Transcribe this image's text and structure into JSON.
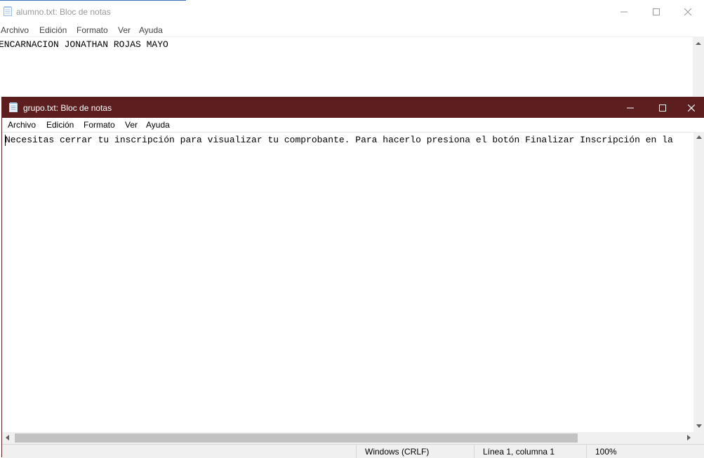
{
  "back_window": {
    "title": "alumno.txt: Bloc de notas",
    "menu": [
      "Archivo",
      "Edición",
      "Formato",
      "Ver",
      "Ayuda"
    ],
    "content": "ENCARNACION JONATHAN ROJAS MAYO"
  },
  "front_window": {
    "title": "grupo.txt: Bloc de notas",
    "titlebar_color": "#5c1e1e",
    "menu": [
      "Archivo",
      "Edición",
      "Formato",
      "Ver",
      "Ayuda"
    ],
    "content": "Necesitas cerrar tu inscripción para visualizar tu comprobante. Para hacerlo presiona el botón Finalizar Inscripción en la",
    "status": {
      "line_ending": "Windows (CRLF)",
      "position": "Línea 1, columna 1",
      "zoom": "100%"
    }
  },
  "icons": {
    "app": "notepad-icon",
    "minimize": "minimize-icon",
    "maximize": "maximize-icon",
    "close": "close-icon"
  }
}
